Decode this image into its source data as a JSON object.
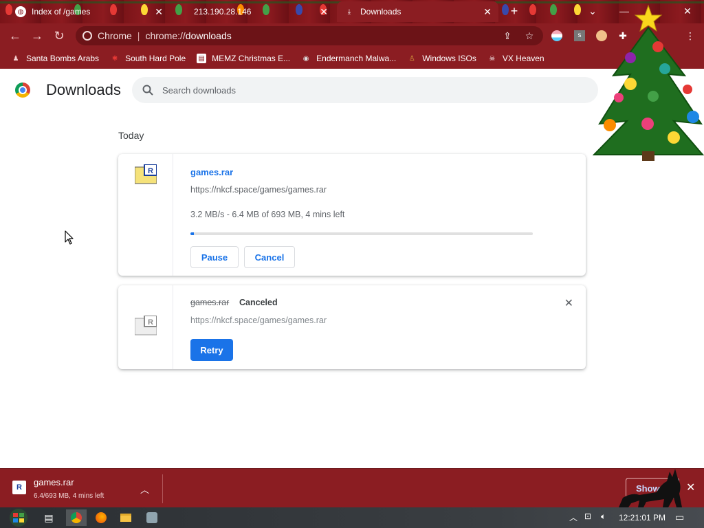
{
  "tabs": [
    {
      "title": "Index of /games",
      "favicon": "globe-icon",
      "active": false
    },
    {
      "title": "213.190.28.146",
      "favicon": "none",
      "active": false
    },
    {
      "title": "Downloads",
      "favicon": "download-icon",
      "active": true
    }
  ],
  "omnibox": {
    "host_label": "Chrome",
    "separator": "|",
    "scheme": "chrome://",
    "path": "downloads"
  },
  "bookmarks": [
    {
      "label": "Santa Bombs Arabs",
      "icon": "santa-icon"
    },
    {
      "label": "South Hard Pole",
      "icon": "star-icon"
    },
    {
      "label": "MEMZ Christmas E...",
      "icon": "document-icon"
    },
    {
      "label": "Endermanch Malwa...",
      "icon": "wolf-icon"
    },
    {
      "label": "Windows ISOs",
      "icon": "figure-icon"
    },
    {
      "label": "VX Heaven",
      "icon": "skull-icon"
    }
  ],
  "page": {
    "title": "Downloads",
    "search_placeholder": "Search downloads",
    "section_label": "Today"
  },
  "downloads": [
    {
      "name": "games.rar",
      "url": "https://nkcf.space/games/games.rar",
      "status": "3.2 MB/s - 6.4 MB of 693 MB, 4 mins left",
      "progress": 0.01,
      "buttons": {
        "pause": "Pause",
        "cancel": "Cancel"
      }
    },
    {
      "name": "games.rar",
      "state": "Canceled",
      "url": "https://nkcf.space/games/games.rar",
      "buttons": {
        "retry": "Retry"
      }
    }
  ],
  "shelf": {
    "name": "games.rar",
    "status": "6.4/693 MB, 4 mins left",
    "show_all": "Show all"
  },
  "taskbar": {
    "clock": "12:21:01 PM"
  },
  "colors": {
    "frame": "#8b1d22",
    "accent": "#1a73e8"
  }
}
